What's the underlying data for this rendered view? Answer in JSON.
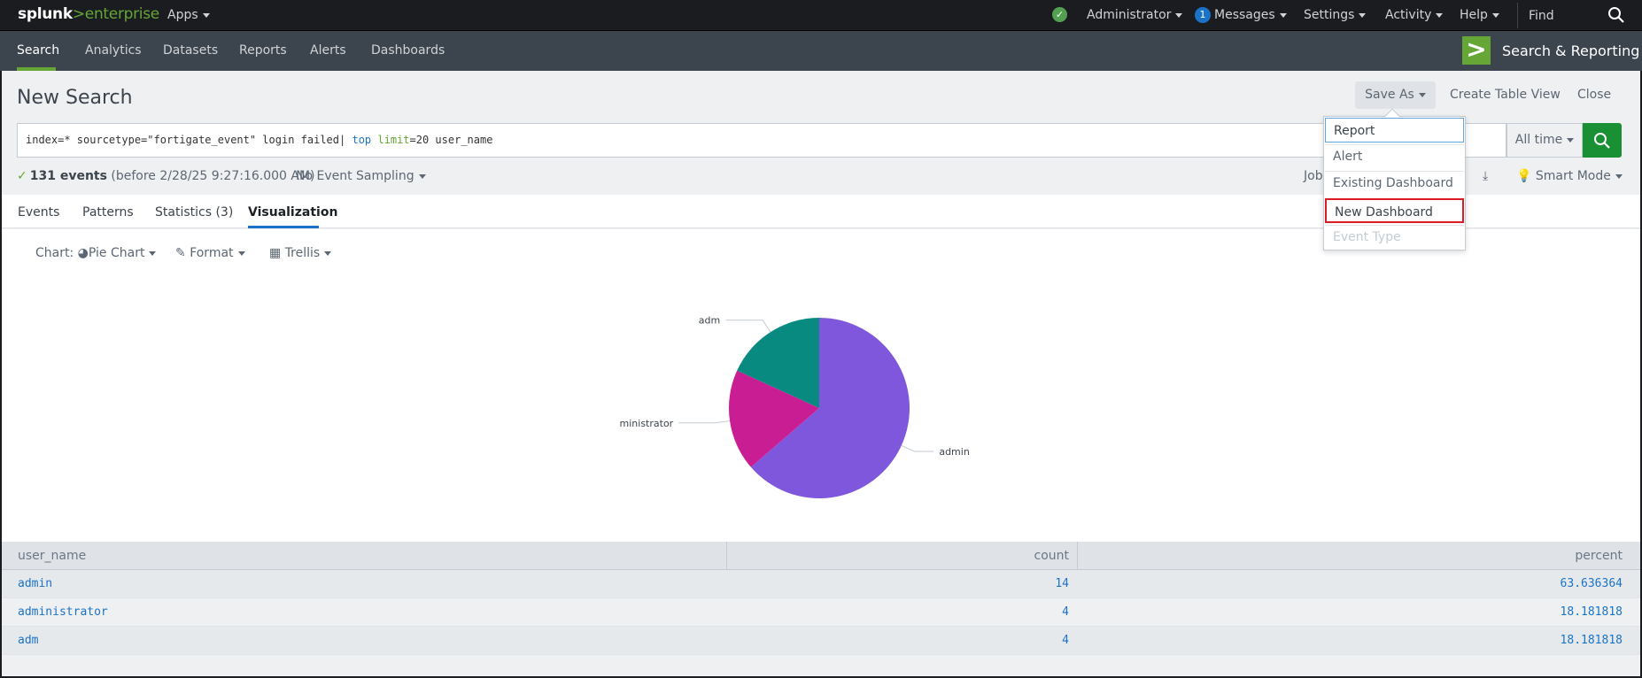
{
  "topbar": {
    "logo_main": "splunk",
    "logo_gt": ">",
    "logo_ent": "enterprise",
    "apps": "Apps",
    "user": "Administrator",
    "messages_count": "1",
    "messages": "Messages",
    "settings": "Settings",
    "activity": "Activity",
    "help": "Help",
    "find": "Find"
  },
  "appbar": {
    "items": [
      "Search",
      "Analytics",
      "Datasets",
      "Reports",
      "Alerts",
      "Dashboards"
    ],
    "app_title": "Search & Reporting"
  },
  "page": {
    "title": "New Search",
    "save_as": "Save As",
    "create_table_view": "Create Table View",
    "close": "Close"
  },
  "search": {
    "q_part1": "index=* sourcetype=\"fortigate_event\" login failed| ",
    "q_kw": "top",
    "q_space": " ",
    "q_arg": "limit",
    "q_part2": "=20 user_name",
    "time_range": "All time"
  },
  "status": {
    "events": "131 events",
    "before": "(before 2/28/25 9:27:16.000 AM)",
    "sampling": "No Event Sampling",
    "job": "Job",
    "mode": "Smart Mode"
  },
  "tabs": [
    "Events",
    "Patterns",
    "Statistics (3)",
    "Visualization"
  ],
  "viz_controls": {
    "chart_prefix": "Chart:",
    "chart_type": "Pie Chart",
    "format": "Format",
    "trellis": "Trellis"
  },
  "dropdown": {
    "items": [
      "Report",
      "Alert",
      "Existing Dashboard",
      "New Dashboard",
      "Event Type"
    ]
  },
  "colors": {
    "admin": "#7f57dc",
    "administrator": "#c91d94",
    "adm": "#088a80",
    "accent_green": "#65a637",
    "link_blue": "#1a73c8"
  },
  "chart_data": {
    "type": "pie",
    "categories": [
      "admin",
      "administrator",
      "adm"
    ],
    "values": [
      14,
      4,
      4
    ]
  },
  "table": {
    "headers": [
      "user_name",
      "count",
      "percent"
    ],
    "rows": [
      [
        "admin",
        "14",
        "63.636364"
      ],
      [
        "administrator",
        "4",
        "18.181818"
      ],
      [
        "adm",
        "4",
        "18.181818"
      ]
    ]
  }
}
